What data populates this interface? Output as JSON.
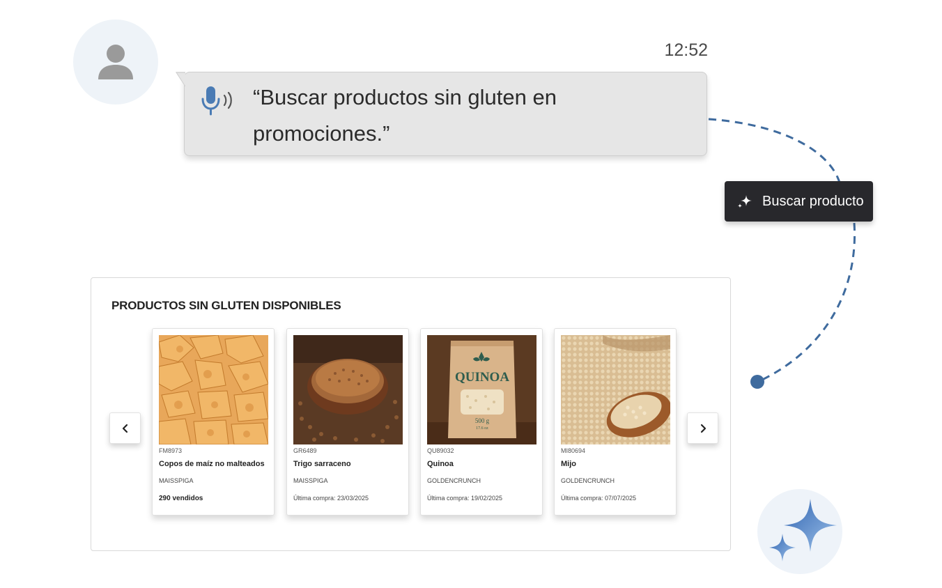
{
  "user": {
    "avatar_icon": "user-silhouette-icon"
  },
  "message": {
    "time": "12:52",
    "voice_icon": "microphone-voice-icon",
    "text": "“Buscar productos sin gluten en promociones.”"
  },
  "action": {
    "icon": "sparkle-icon",
    "label": "Buscar producto"
  },
  "results": {
    "title": "PRODUCTOS SIN GLUTEN DISPONIBLES",
    "prev_icon": "chevron-left-icon",
    "next_icon": "chevron-right-icon",
    "products": [
      {
        "code": "FM8973",
        "name": "Copos de maíz no malteados",
        "brand": "MAISSPIGA",
        "extra": "290 vendidos"
      },
      {
        "code": "GR6489",
        "name": "Trigo sarraceno",
        "brand": "MAISSPIGA",
        "extra": "Última compra: 23/03/2025"
      },
      {
        "code": "QU89032",
        "name": "Quinoa",
        "brand": "GOLDENCRUNCH",
        "extra": "Última compra: 19/02/2025",
        "package_label": "QUINOA",
        "package_weight": "500 g",
        "package_weight_oz": "17.6 oz"
      },
      {
        "code": "MI80694",
        "name": "Mijo",
        "brand": "GOLDENCRUNCH",
        "extra": "Última compra: 07/07/2025"
      }
    ]
  },
  "assistant": {
    "icon": "ai-sparkles-icon"
  },
  "colors": {
    "accent": "#3f6b9e",
    "chip_bg": "#28282c",
    "bubble_bg": "#e6e6e6",
    "orb_bg": "#eef3f9"
  }
}
